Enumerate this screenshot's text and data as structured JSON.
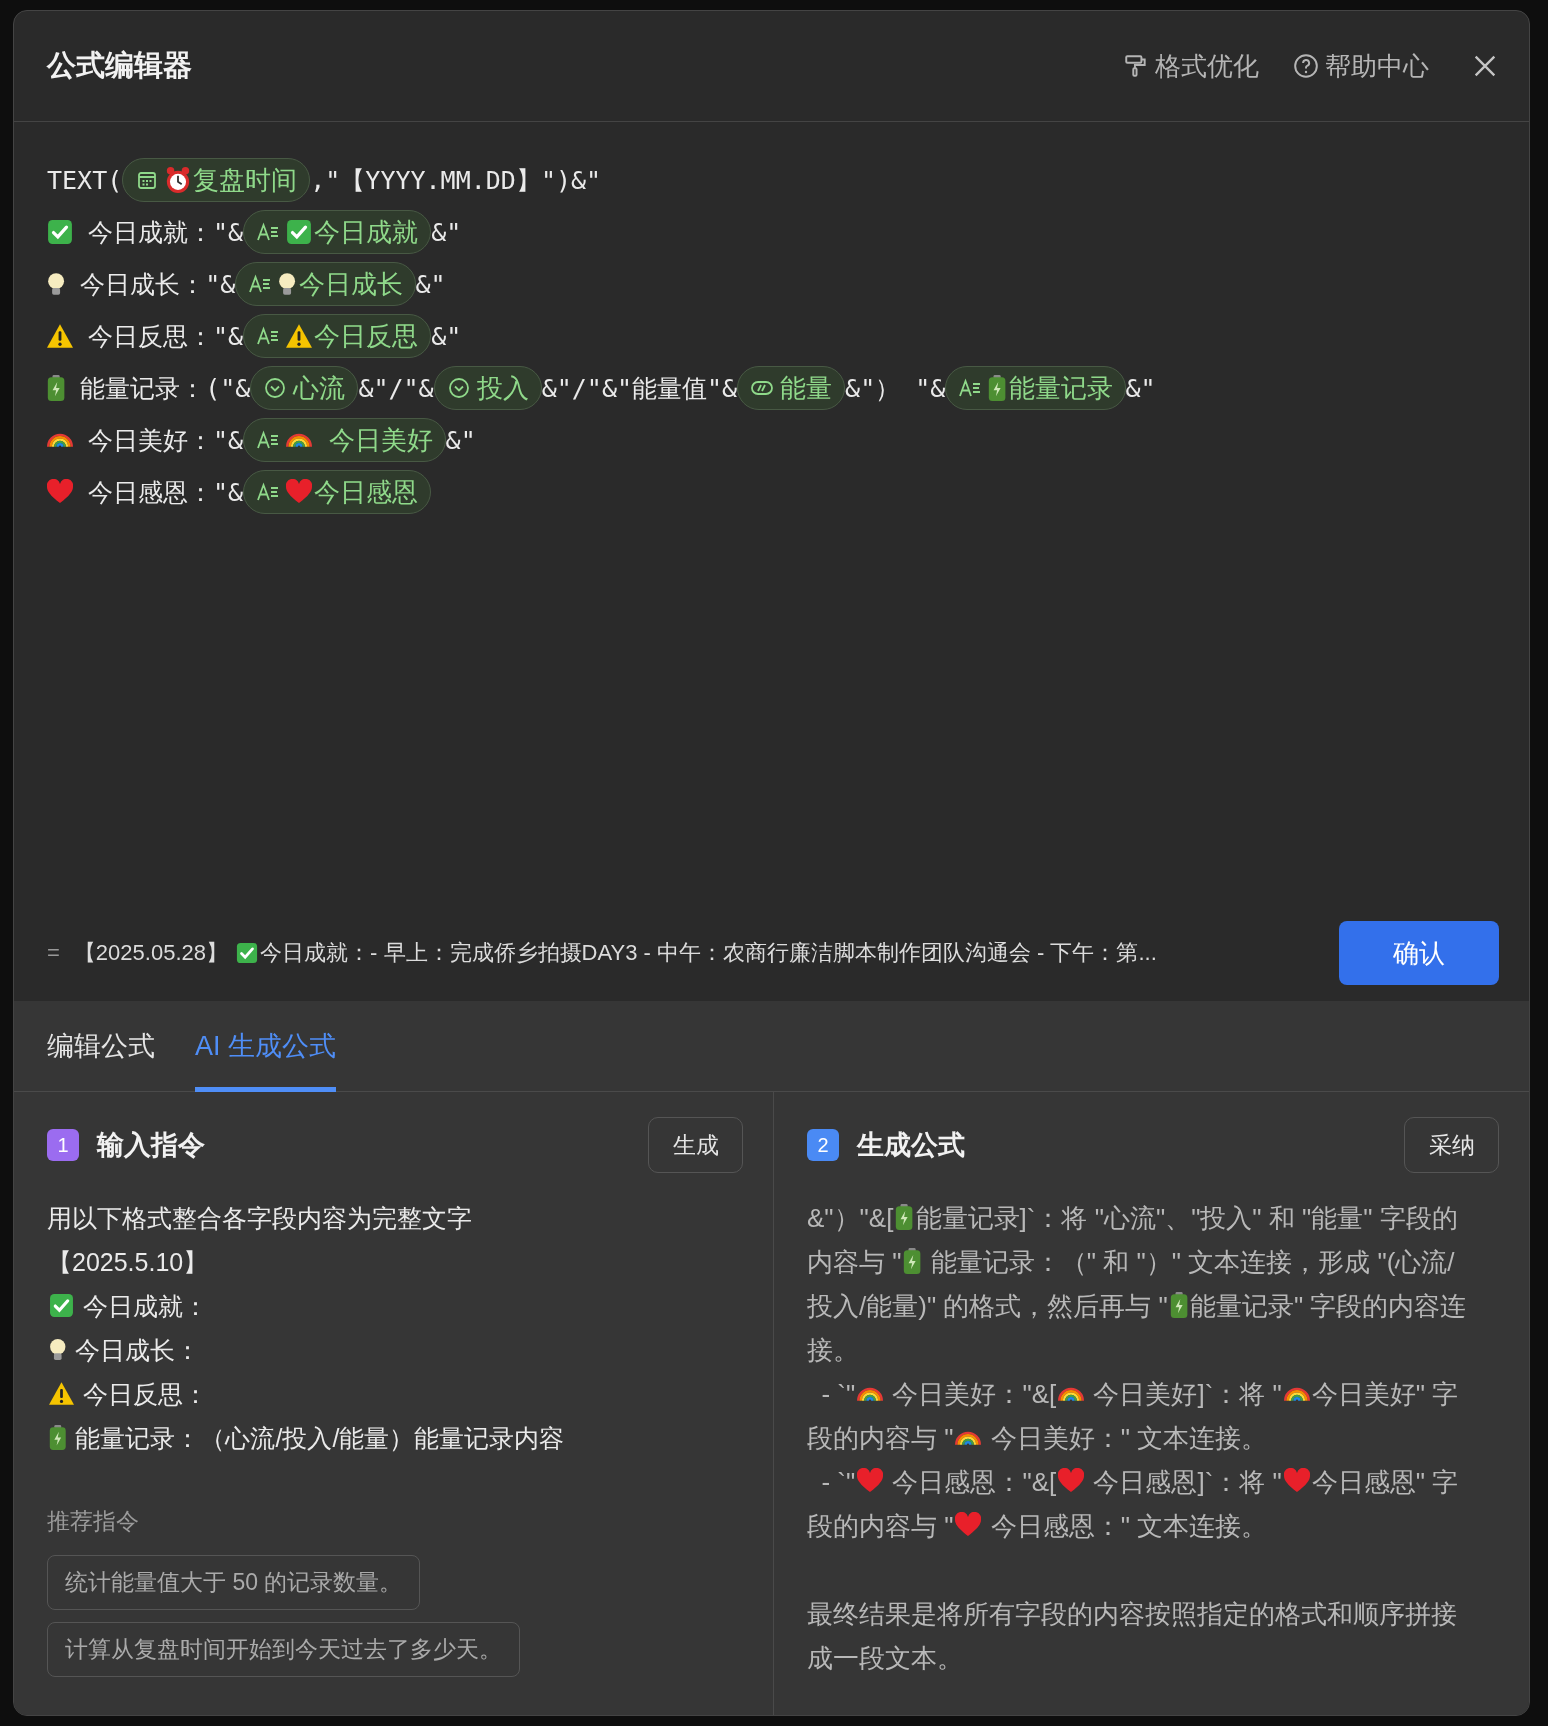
{
  "dialog": {
    "title": "公式编辑器",
    "actions": [
      "格式优化",
      "帮助中心"
    ]
  },
  "formula": {
    "lines": [
      [
        {
          "kind": "text",
          "text": "TEXT("
        },
        {
          "kind": "date",
          "parts": [
            {
              "kind": "alarm"
            },
            {
              "kind": "text",
              "text": "复盘时间"
            }
          ]
        },
        {
          "kind": "text",
          "text": ",\"【YYYY.MM.DD】\")&\""
        }
      ],
      [
        {
          "kind": "check"
        },
        {
          "kind": "text",
          "text": " 今日成就：\"&"
        },
        {
          "kind": "textfield",
          "parts": [
            {
              "kind": "check"
            },
            {
              "kind": "text",
              "text": "今日成就"
            }
          ]
        },
        {
          "kind": "text",
          "text": "&\""
        }
      ],
      [
        {
          "kind": "bulb"
        },
        {
          "kind": "text",
          "text": " 今日成长：\"&"
        },
        {
          "kind": "textfield",
          "parts": [
            {
              "kind": "bulb"
            },
            {
              "kind": "text",
              "text": "今日成长"
            }
          ]
        },
        {
          "kind": "text",
          "text": "&\""
        }
      ],
      [
        {
          "kind": "warning"
        },
        {
          "kind": "text",
          "text": " 今日反思：\"&"
        },
        {
          "kind": "textfield",
          "parts": [
            {
              "kind": "warning"
            },
            {
              "kind": "text",
              "text": "今日反思"
            }
          ]
        },
        {
          "kind": "text",
          "text": "&\""
        }
      ],
      [
        {
          "kind": "battery"
        },
        {
          "kind": "text",
          "text": " 能量记录：(\"&"
        },
        {
          "kind": "select",
          "parts": [
            {
              "kind": "text",
              "text": "心流"
            }
          ]
        },
        {
          "kind": "text",
          "text": "&\"/\"&"
        },
        {
          "kind": "select",
          "parts": [
            {
              "kind": "text",
              "text": "投入"
            }
          ]
        },
        {
          "kind": "text",
          "text": "&\"/\"&\"能量值\"&"
        },
        {
          "kind": "progress",
          "parts": [
            {
              "kind": "text",
              "text": "能量"
            }
          ]
        },
        {
          "kind": "text",
          "text": "&\"） \"&"
        },
        {
          "kind": "textfield",
          "parts": [
            {
              "kind": "battery"
            },
            {
              "kind": "text",
              "text": "能量记录"
            }
          ]
        },
        {
          "kind": "text",
          "text": "&\""
        }
      ],
      [
        {
          "kind": "rainbow"
        },
        {
          "kind": "text",
          "text": " 今日美好：\"&"
        },
        {
          "kind": "textfield",
          "parts": [
            {
              "kind": "rainbow"
            },
            {
              "kind": "text",
              "text": "  今日美好"
            }
          ]
        },
        {
          "kind": "text",
          "text": "&\""
        }
      ],
      [
        {
          "kind": "heart"
        },
        {
          "kind": "text",
          "text": " 今日感恩：\"&"
        },
        {
          "kind": "textfield",
          "parts": [
            {
              "kind": "heart"
            },
            {
              "kind": "text",
              "text": "今日感恩"
            }
          ]
        }
      ]
    ],
    "result_prefix": "=",
    "result": [
      {
        "kind": "text",
        "text": "【2025.05.28】 "
      },
      {
        "kind": "check"
      },
      {
        "kind": "text",
        "text": "今日成就：- 早上：完成侨乡拍摄DAY3 - 中午：农商行廉洁脚本制作团队沟通会 - 下午：第..."
      }
    ],
    "confirm_button": "确认"
  },
  "tabs": [
    {
      "label": "编辑公式",
      "selected": false
    },
    {
      "label": "AI 生成公式",
      "selected": true
    }
  ],
  "input_panel": {
    "step": "1",
    "title": "输入指令",
    "button": "生成",
    "lines": [
      [
        {
          "kind": "text",
          "text": "用以下格式整合各字段内容为完整文字"
        }
      ],
      [
        {
          "kind": "text",
          "text": "【2025.5.10】"
        }
      ],
      [
        {
          "kind": "check"
        },
        {
          "kind": "text",
          "text": " 今日成就："
        }
      ],
      [
        {
          "kind": "bulb"
        },
        {
          "kind": "text",
          "text": " 今日成长："
        }
      ],
      [
        {
          "kind": "warning"
        },
        {
          "kind": "text",
          "text": " 今日反思："
        }
      ],
      [
        {
          "kind": "battery"
        },
        {
          "kind": "text",
          "text": " 能量记录：（心流/投入/能量）能量记录内容"
        }
      ]
    ],
    "suggestions_label": "推荐指令",
    "suggestions": [
      "统计能量值大于 50 的记录数量。",
      "计算从复盘时间开始到今天过去了多少天。"
    ]
  },
  "output_panel": {
    "step": "2",
    "title": "生成公式",
    "button": "采纳",
    "paragraphs": [
      [
        {
          "kind": "text",
          "text": "&\"）\"&["
        },
        {
          "kind": "battery"
        },
        {
          "kind": "text",
          "text": "能量记录]`：将 \"心流\"、\"投入\" 和 \"能量\" 字段的内容与 \""
        },
        {
          "kind": "battery"
        },
        {
          "kind": "text",
          "text": " 能量记录：（\" 和 \"）\" 文本连接，形成 \"(心流/投入/能量)\" 的格式，然后再与 \""
        },
        {
          "kind": "battery"
        },
        {
          "kind": "text",
          "text": "能量记录\" 字段的内容连接。"
        }
      ],
      [
        {
          "kind": "text",
          "text": "  - `\""
        },
        {
          "kind": "rainbow"
        },
        {
          "kind": "text",
          "text": " 今日美好：\"&["
        },
        {
          "kind": "rainbow"
        },
        {
          "kind": "text",
          "text": " 今日美好]`：将 \""
        },
        {
          "kind": "rainbow"
        },
        {
          "kind": "text",
          "text": "今日美好\" 字段的内容与 \""
        },
        {
          "kind": "rainbow"
        },
        {
          "kind": "text",
          "text": " 今日美好：\" 文本连接。"
        }
      ],
      [
        {
          "kind": "text",
          "text": "  - `\""
        },
        {
          "kind": "heart"
        },
        {
          "kind": "text",
          "text": " 今日感恩：\"&["
        },
        {
          "kind": "heart"
        },
        {
          "kind": "text",
          "text": " 今日感恩]`：将 \""
        },
        {
          "kind": "heart"
        },
        {
          "kind": "text",
          "text": "今日感恩\" 字段的内容与 \""
        },
        {
          "kind": "heart"
        },
        {
          "kind": "text",
          "text": " 今日感恩：\" 文本连接。"
        }
      ],
      [
        {
          "kind": "text",
          "text": "最终结果是将所有字段的内容按照指定的格式和顺序拼接成一段文本。"
        }
      ]
    ]
  }
}
